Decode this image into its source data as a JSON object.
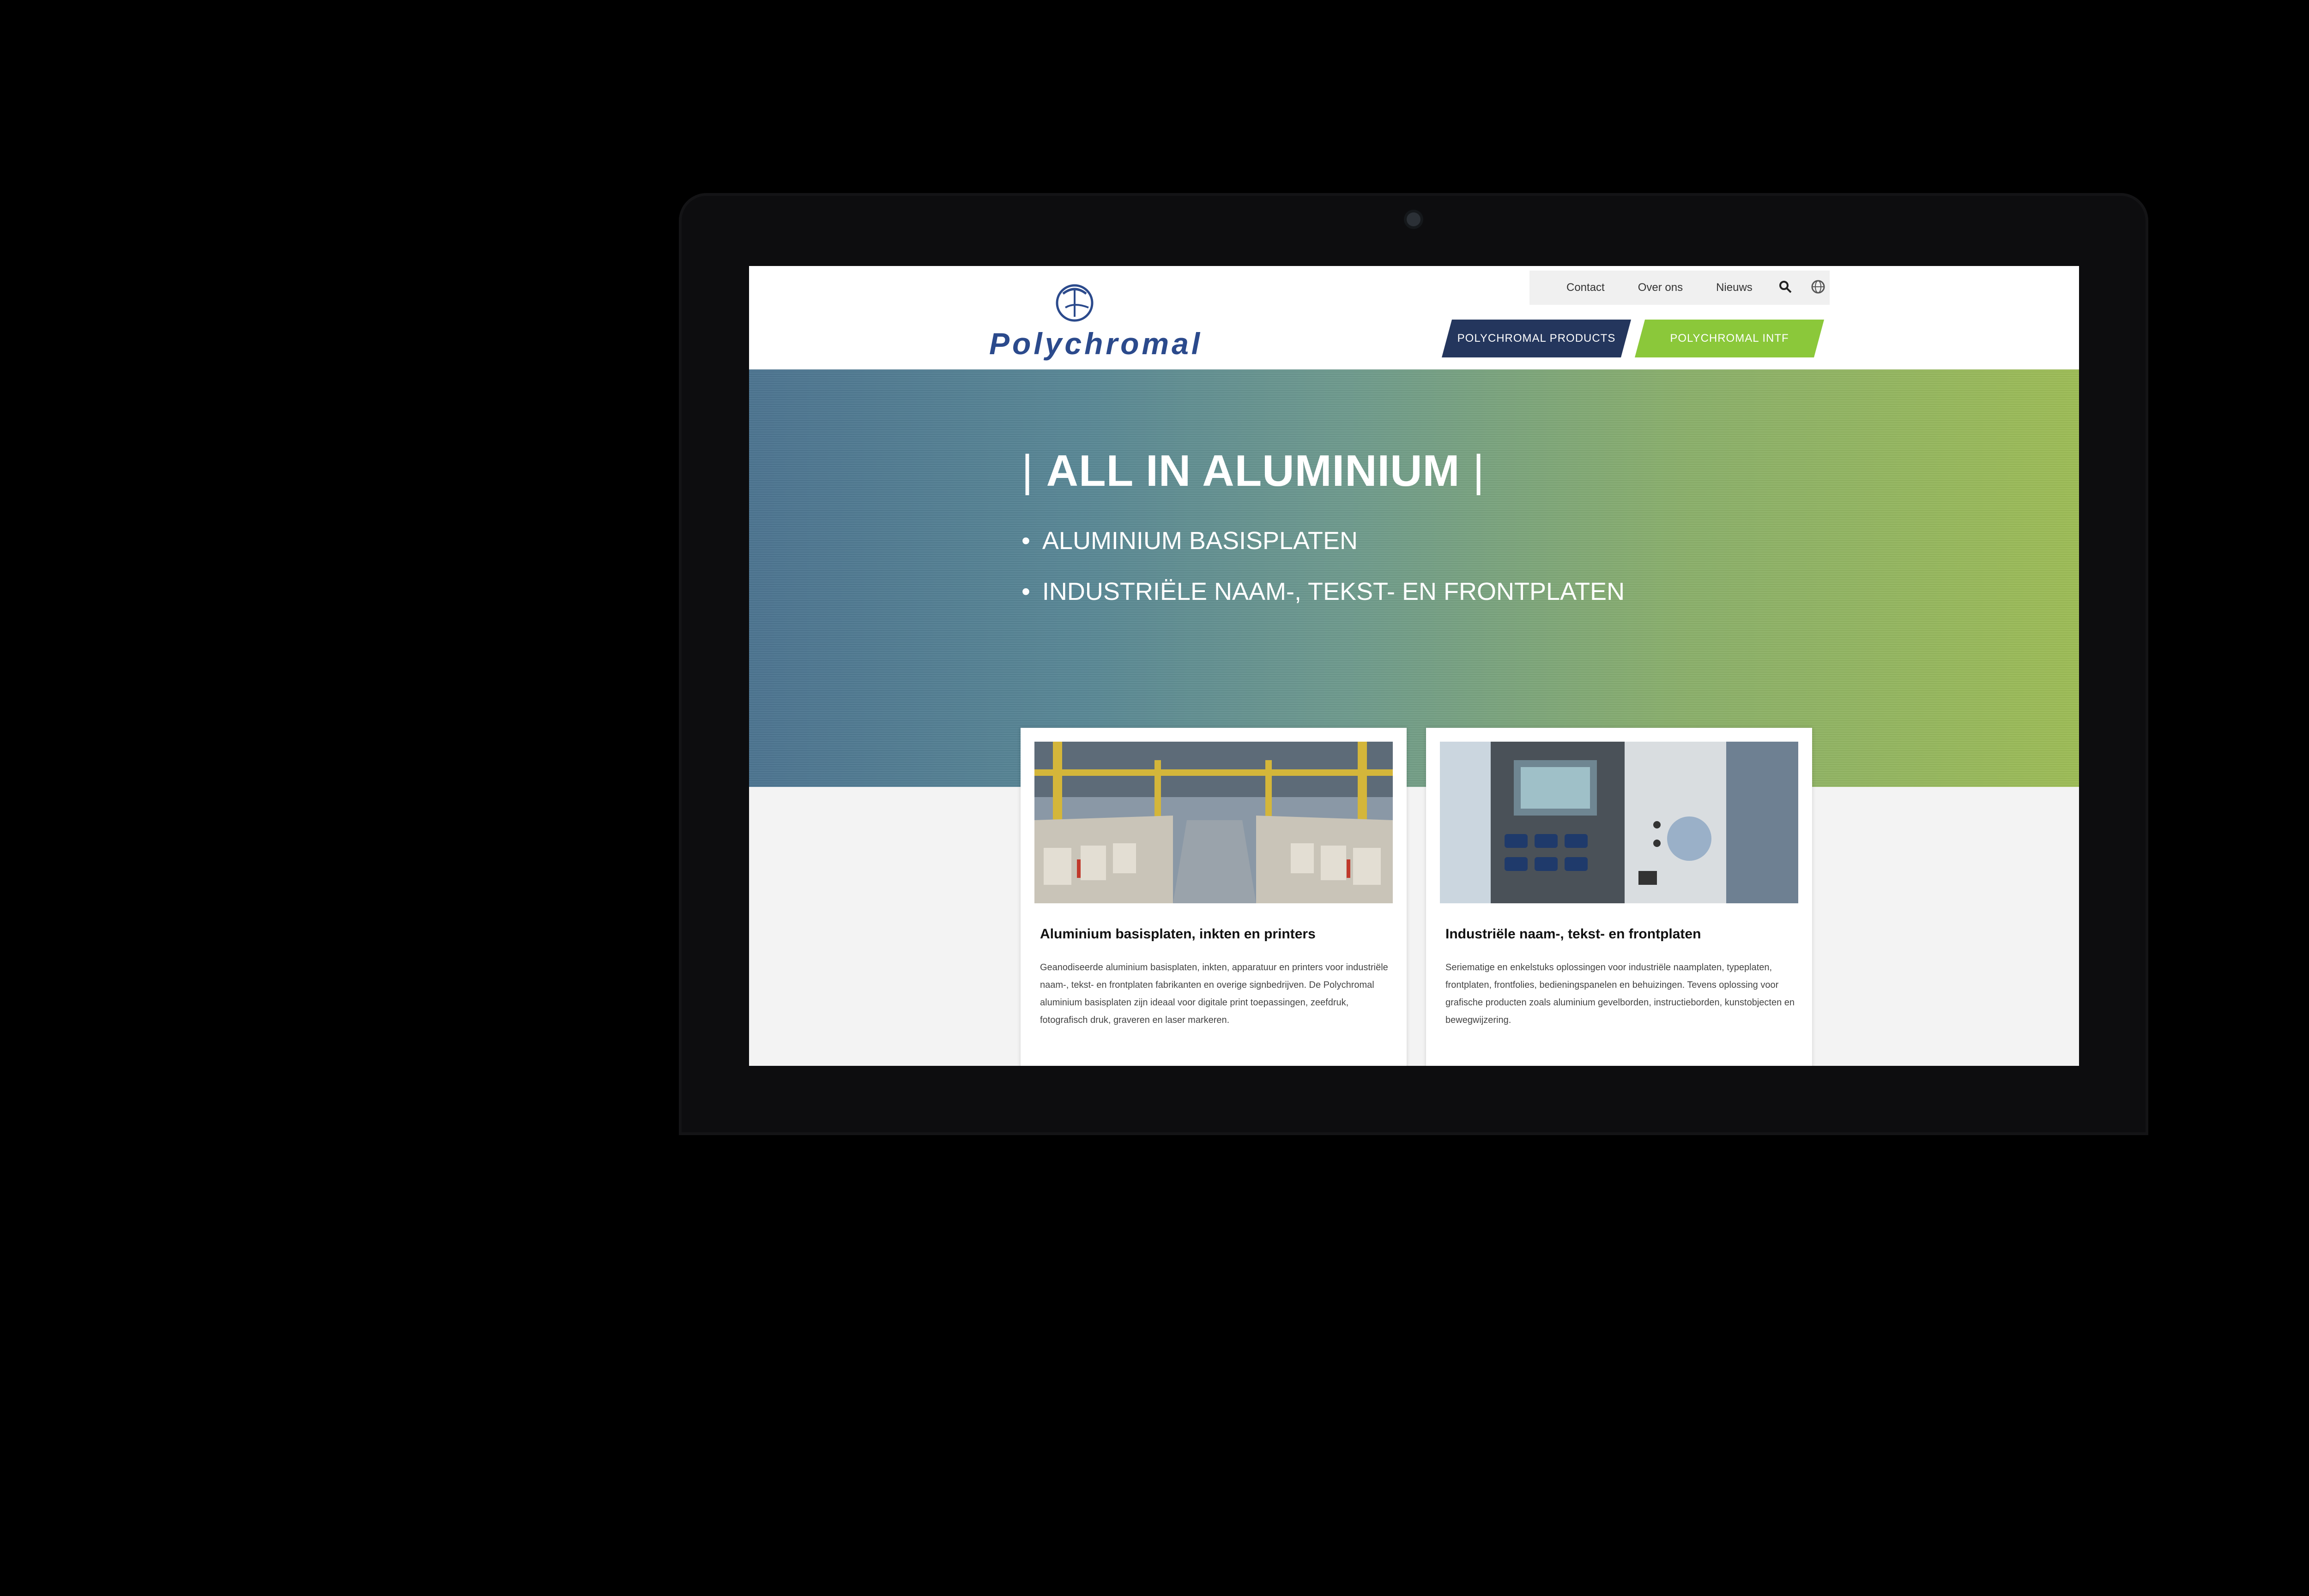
{
  "brand": {
    "name": "Polychromal",
    "color": "#2b4a8c"
  },
  "top_nav": {
    "contact": "Contact",
    "over_ons": "Over ons",
    "nieuws": "Nieuws"
  },
  "tabs": [
    {
      "label": "POLYCHROMAL PRODUCTS",
      "color": "#24365d"
    },
    {
      "label": "POLYCHROMAL INTF",
      "color": "#8bc83a"
    }
  ],
  "hero": {
    "title": "ALL IN ALUMINIUM",
    "bullets": [
      "ALUMINIUM BASISPLATEN",
      "INDUSTRIËLE NAAM-, TEKST- EN FRONTPLATEN"
    ]
  },
  "cards": [
    {
      "title": "Aluminium basisplaten, inkten en printers",
      "body": "Geanodiseerde aluminium basisplaten, inkten, apparatuur en printers voor industriële naam-, tekst- en frontplaten fabrikanten en overige signbedrijven. De Polychromal aluminium basisplaten zijn ideaal voor digitale print toepassingen, zeefdruk, fotografisch druk, graveren en laser markeren."
    },
    {
      "title": "Industriële naam-, tekst- en frontplaten",
      "body": "Seriematige en enkelstuks oplossingen voor industriële naamplaten, typeplaten, frontplaten, frontfolies, bedieningspanelen en behuizingen. Tevens oplossing voor grafische producten zoals aluminium gevelborden, instructieborden, kunstobjecten en bewegwijzering."
    }
  ]
}
